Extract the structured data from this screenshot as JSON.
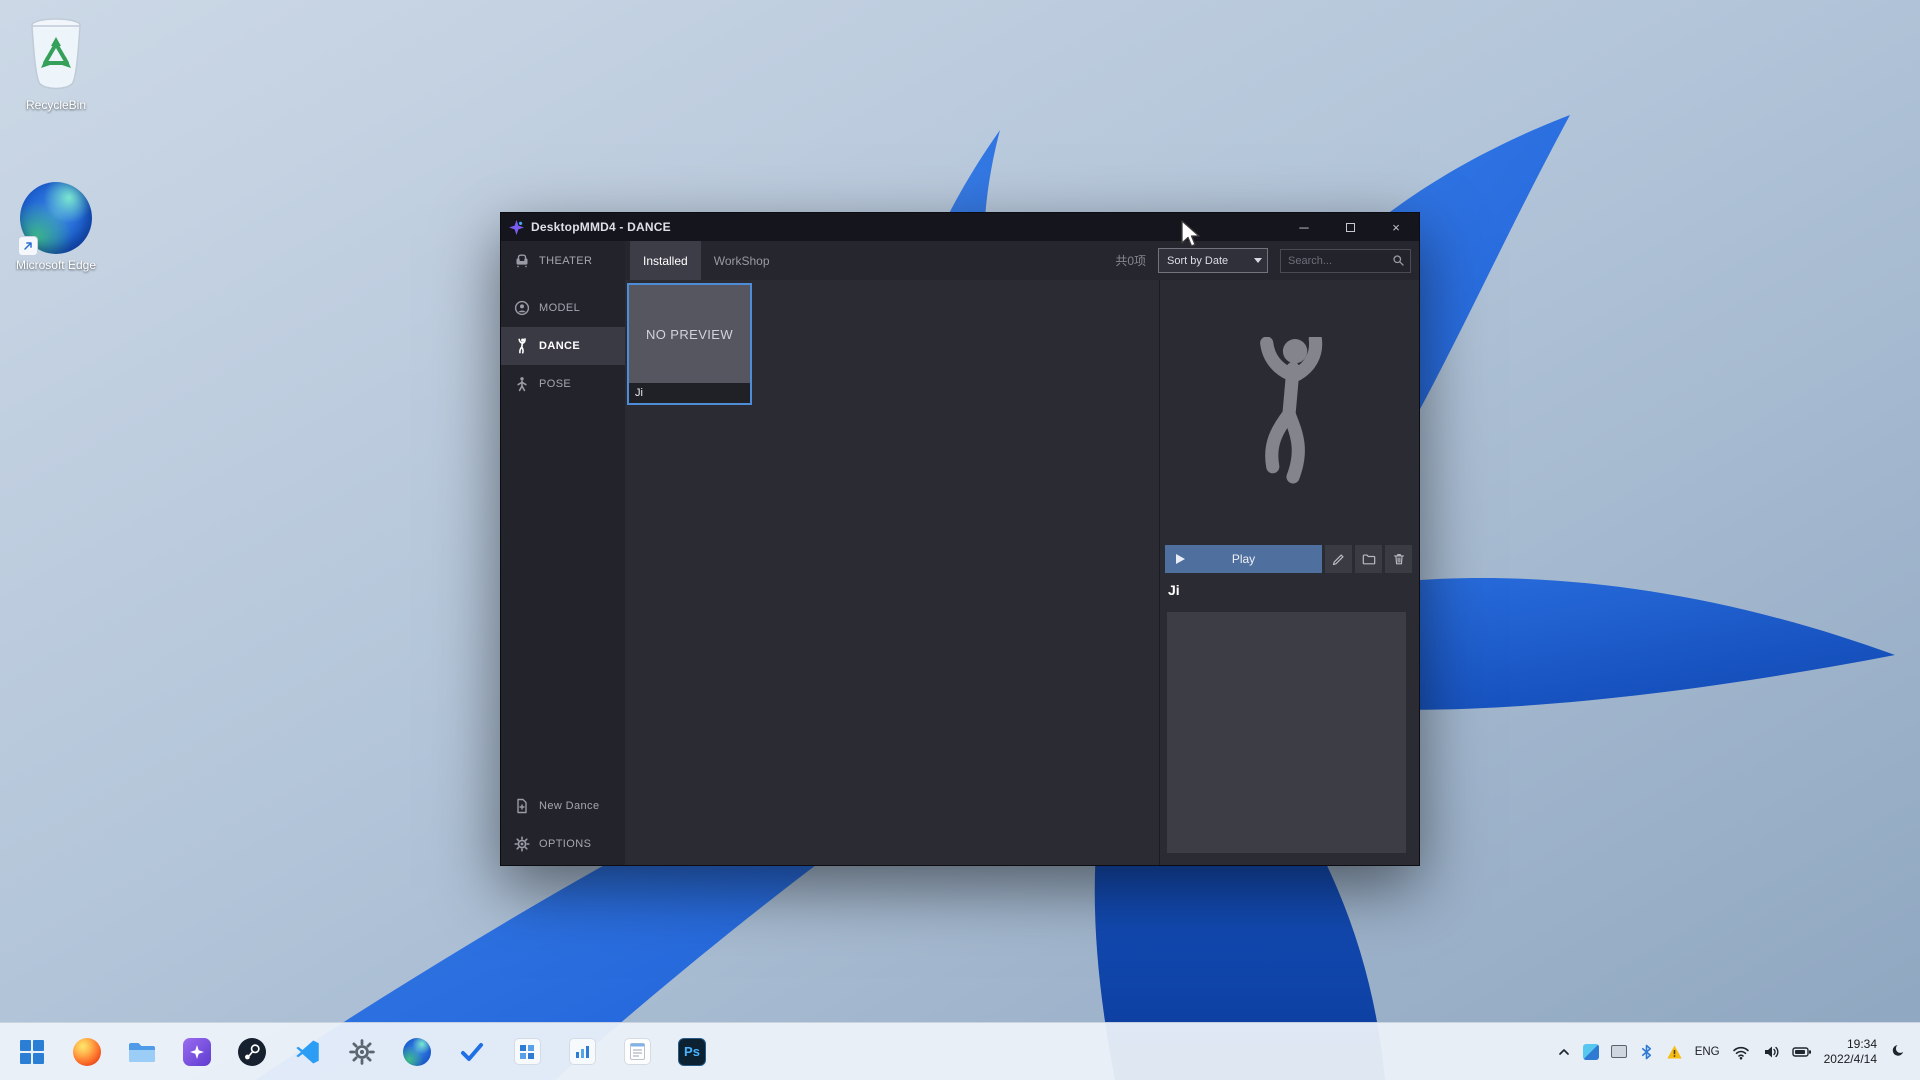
{
  "desktop": {
    "icons": [
      {
        "label": "RecycleBin",
        "icon": "recycle-bin-icon"
      },
      {
        "label": "Microsoft Edge",
        "icon": "edge-icon"
      }
    ]
  },
  "window": {
    "title": "DesktopMMD4 - DANCE",
    "controls": {
      "minimize": "─",
      "close": "×"
    },
    "sidebar": {
      "items": [
        {
          "label": "THEATER",
          "icon": "theater-seat-icon"
        },
        {
          "label": "MODEL",
          "icon": "model-icon"
        },
        {
          "label": "DANCE",
          "icon": "dance-icon",
          "selected": true
        },
        {
          "label": "POSE",
          "icon": "pose-icon"
        }
      ],
      "bottom_items": [
        {
          "label": "New Dance",
          "icon": "new-dance-icon"
        },
        {
          "label": "OPTIONS",
          "icon": "gear-icon"
        }
      ]
    },
    "topbar": {
      "tabs": [
        {
          "label": "Installed",
          "active": true
        },
        {
          "label": "WorkShop",
          "active": false
        }
      ],
      "items_count": "共0项",
      "sort_value": "Sort by Date",
      "search_placeholder": "Search..."
    },
    "grid": {
      "tiles": [
        {
          "preview_text": "NO PREVIEW",
          "name": "Ji",
          "selected": true
        }
      ]
    },
    "detail": {
      "play_label": "Play",
      "item_name": "Ji",
      "action_icons": [
        "edit-icon",
        "folder-icon",
        "trash-icon"
      ]
    }
  },
  "taskbar": {
    "apps": [
      "start",
      "firefox",
      "file-explorer",
      "desktopmmd",
      "steam",
      "vscode",
      "settings",
      "edge",
      "todo-check",
      "store-app",
      "stats-app",
      "notepad",
      "photoshop"
    ],
    "photoshop_label": "Ps",
    "tray": {
      "icons": [
        "chevron-up",
        "tray-app",
        "device",
        "bluetooth",
        "warning",
        "wifi",
        "volume",
        "battery",
        "moon"
      ],
      "language": "ENG",
      "time": "19:34",
      "date": "2022/4/14"
    }
  },
  "colors": {
    "selection_blue": "#4e8cd8",
    "play_button": "#4f6f9f",
    "titlebar": "#15151d",
    "taskbar": "#edf2f9"
  }
}
